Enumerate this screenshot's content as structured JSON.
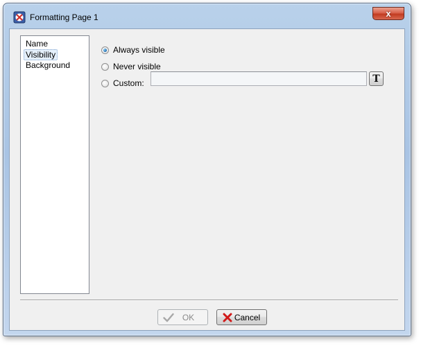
{
  "window": {
    "title": "Formatting Page 1",
    "close_glyph": "x"
  },
  "nav": {
    "items": [
      {
        "label": "Name",
        "selected": false
      },
      {
        "label": "Visibility",
        "selected": true
      },
      {
        "label": "Background",
        "selected": false
      }
    ]
  },
  "visibility": {
    "options": [
      {
        "label": "Always visible",
        "checked": true
      },
      {
        "label": "Never visible",
        "checked": false
      },
      {
        "label": "Custom:",
        "checked": false
      }
    ],
    "custom_value": "",
    "expression_button_glyph": "T"
  },
  "footer": {
    "ok_label": "OK",
    "ok_enabled": false,
    "cancel_label": "Cancel"
  },
  "colors": {
    "selection_bg": "#e5f0fb",
    "cancel_icon": "#d11a1a",
    "ok_icon_disabled": "#a8a8a8"
  }
}
